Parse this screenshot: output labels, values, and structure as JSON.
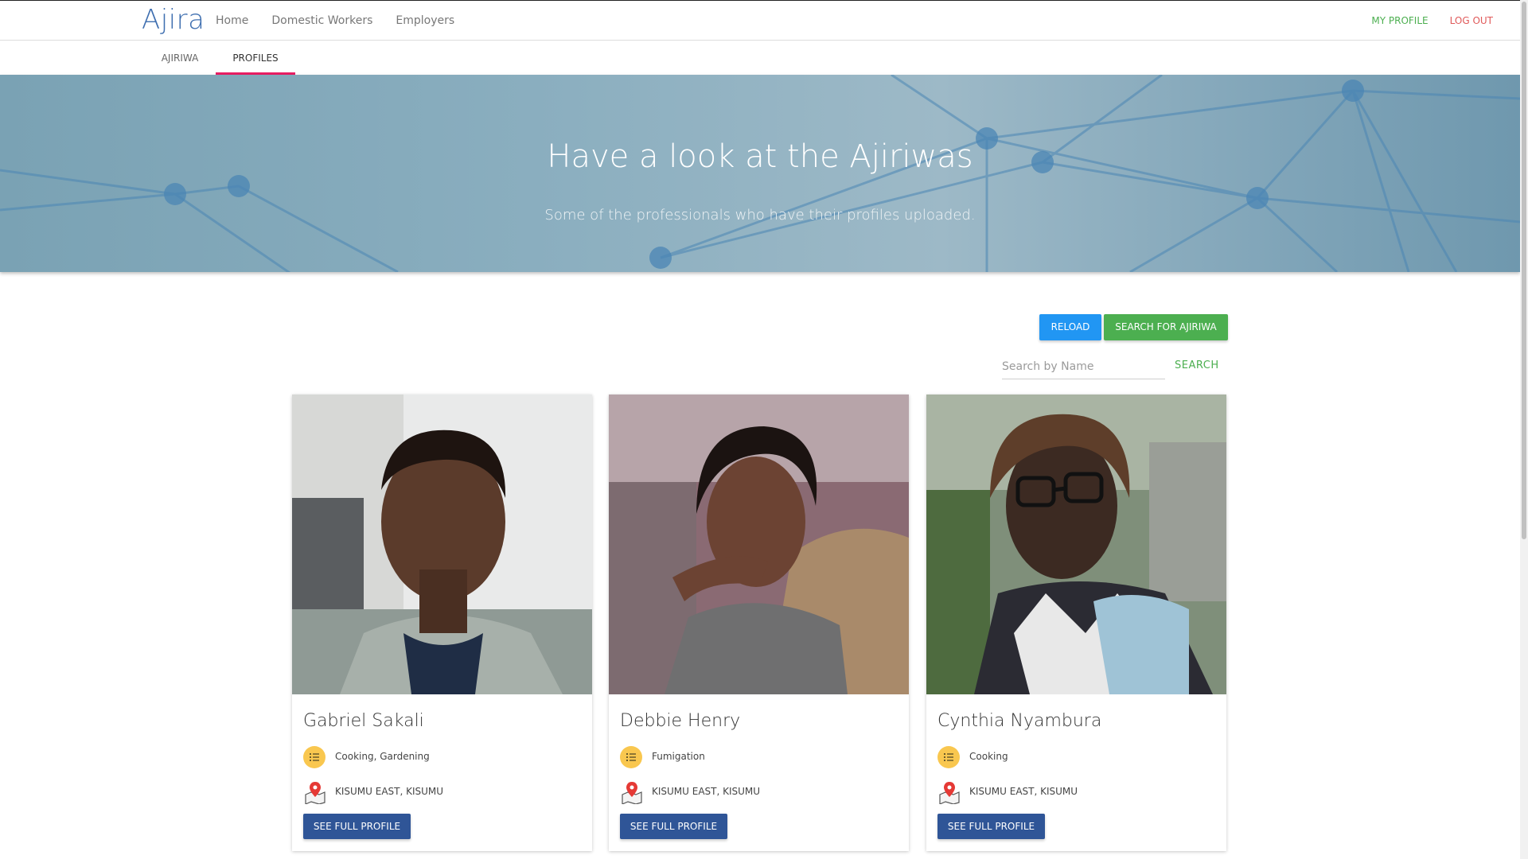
{
  "navbar": {
    "brand": "Ajira",
    "links": [
      "Home",
      "Domestic Workers",
      "Employers"
    ],
    "my_profile": "MY PROFILE",
    "logout": "LOG OUT"
  },
  "tabs": {
    "ajiriwa": "AJIRIWA",
    "profiles": "PROFILES",
    "active": "PROFILES"
  },
  "hero": {
    "title": "Have a look at the Ajiriwas",
    "subtitle": "Some of the professionals who have their profiles uploaded."
  },
  "actions": {
    "reload": "RELOAD",
    "search_ajiriwa": "SEARCH FOR AJIRIWA"
  },
  "search": {
    "placeholder": "Search by Name",
    "value": "",
    "button": "SEARCH"
  },
  "profiles": [
    {
      "name": "Gabriel Sakali",
      "skills": "Cooking, Gardening",
      "location": "KISUMU EAST, KISUMU",
      "button": "SEE FULL PROFILE"
    },
    {
      "name": "Debbie Henry",
      "skills": "Fumigation",
      "location": "KISUMU EAST, KISUMU",
      "button": "SEE FULL PROFILE"
    },
    {
      "name": "Cynthia Nyambura",
      "skills": "Cooking",
      "location": "KISUMU EAST, KISUMU",
      "button": "SEE FULL PROFILE"
    }
  ],
  "icons": {
    "skills": "list-icon",
    "location": "map-pin-icon"
  },
  "colors": {
    "brand": "#3f6fb0",
    "reload": "#2196f3",
    "search_green": "#4caf50",
    "logout": "#e05a5a",
    "tab_active": "#e91e63",
    "profile_button": "#2f5597"
  }
}
